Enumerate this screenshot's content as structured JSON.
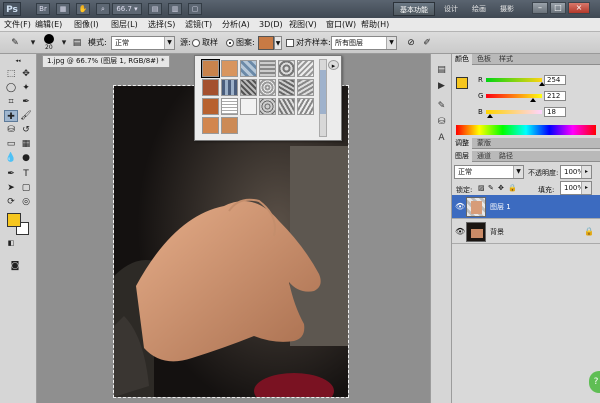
{
  "app": {
    "logo": "Ps",
    "zoom_value": "66.7",
    "workspace_active": "基本功能",
    "workspace_links": [
      "设计",
      "绘画",
      "摄影"
    ],
    "window_buttons": [
      "–",
      "□",
      "×"
    ]
  },
  "menu": [
    "文件(F)",
    "编辑(E)",
    "图像(I)",
    "图层(L)",
    "选择(S)",
    "滤镜(T)",
    "分析(A)",
    "3D(D)",
    "视图(V)",
    "窗口(W)",
    "帮助(H)"
  ],
  "options": {
    "brush_size": "20",
    "mode_label": "模式:",
    "mode_value": "正常",
    "source_label": "源:",
    "sampled_label": "取样",
    "pattern_label": "图案:",
    "aligned_label": "对齐",
    "sample_label": "样本:",
    "sample_value": "所有图层"
  },
  "document": {
    "tab_title": "1.jpg @ 66.7% (图层 1, RGB/8#) *"
  },
  "pattern_popup": {
    "menu_icon": "▸"
  },
  "color_panel": {
    "tabs": [
      "颜色",
      "色板",
      "样式"
    ],
    "r_label": "R",
    "g_label": "G",
    "b_label": "B",
    "r_value": "254",
    "g_value": "212",
    "b_value": "18",
    "r_fraction": 0.996,
    "g_fraction": 0.831,
    "b_fraction": 0.071
  },
  "adjust_panel": {
    "tabs": [
      "调整",
      "蒙版"
    ]
  },
  "layers_panel": {
    "tabs": [
      "图层",
      "通道",
      "路径"
    ],
    "blend_mode": "正常",
    "opacity_label": "不透明度:",
    "opacity_value": "100%",
    "lock_label": "锁定:",
    "fill_label": "填充:",
    "fill_value": "100%",
    "layers": [
      {
        "name": "图层 1",
        "selected": true
      },
      {
        "name": "背景",
        "selected": false
      }
    ]
  },
  "colors": {
    "foreground": "#f6c61e",
    "background": "#ffffff",
    "selection": "#3c6bc0"
  }
}
